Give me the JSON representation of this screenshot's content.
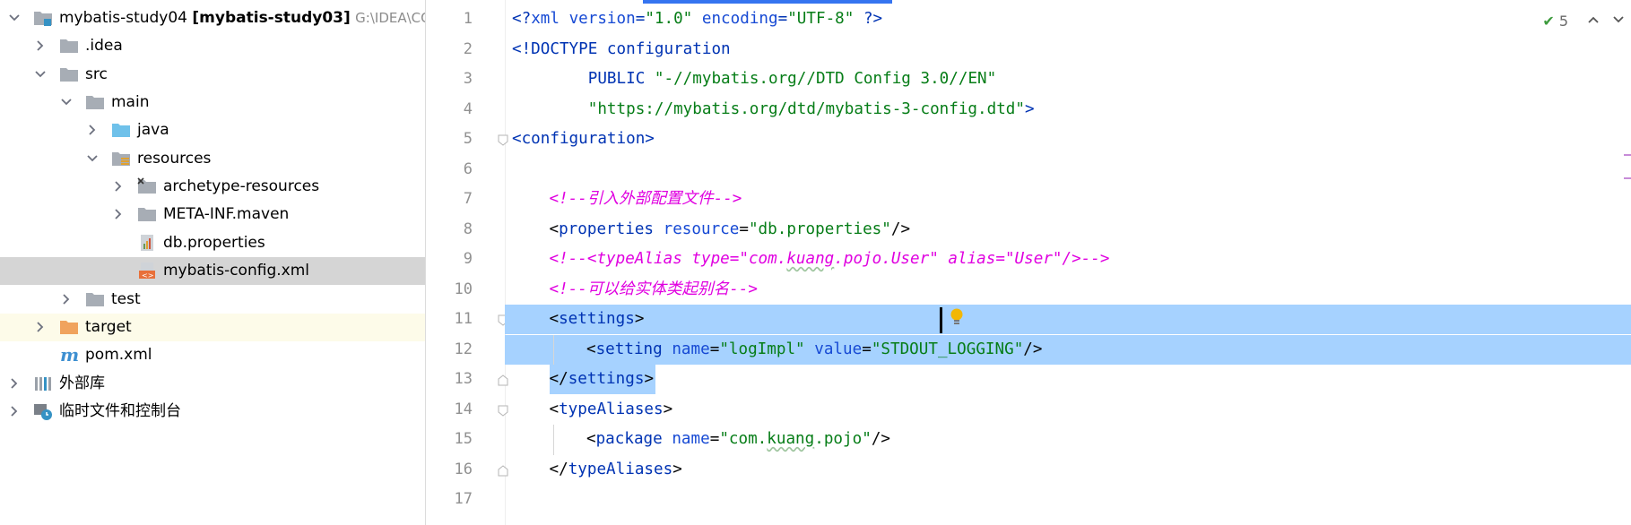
{
  "project_tree": {
    "items": [
      {
        "label": "mybatis-study04",
        "bold": "[mybatis-study03]",
        "path": "G:\\IDEA\\COD",
        "icon": "module-icon",
        "arrow": "down",
        "indent": 0
      },
      {
        "label": ".idea",
        "icon": "folder-icon",
        "arrow": "right",
        "indent": 1
      },
      {
        "label": "src",
        "icon": "folder-icon",
        "arrow": "down",
        "indent": 1
      },
      {
        "label": "main",
        "icon": "folder-icon",
        "arrow": "down",
        "indent": 2
      },
      {
        "label": "java",
        "icon": "source-folder-icon",
        "arrow": "right",
        "indent": 3
      },
      {
        "label": "resources",
        "icon": "resources-folder-icon",
        "arrow": "down",
        "indent": 3
      },
      {
        "label": "archetype-resources",
        "icon": "excluded-folder-icon",
        "arrow": "right",
        "indent": 4
      },
      {
        "label": "META-INF.maven",
        "icon": "folder-icon",
        "arrow": "right",
        "indent": 4
      },
      {
        "label": "db.properties",
        "icon": "properties-file-icon",
        "arrow": "none",
        "indent": 4
      },
      {
        "label": "mybatis-config.xml",
        "icon": "xml-file-icon",
        "arrow": "none",
        "indent": 4,
        "selected": true
      },
      {
        "label": "test",
        "icon": "folder-icon",
        "arrow": "right",
        "indent": 2
      },
      {
        "label": "target",
        "icon": "orange-folder-icon",
        "arrow": "right",
        "indent": 1,
        "excluded": true
      },
      {
        "label": "pom.xml",
        "icon": "maven-icon",
        "arrow": "none",
        "indent": 1
      },
      {
        "label": "外部库",
        "icon": "library-icon",
        "arrow": "right",
        "indent": 0
      },
      {
        "label": "临时文件和控制台",
        "icon": "scratch-icon",
        "arrow": "right",
        "indent": 0
      }
    ]
  },
  "editor": {
    "inspection_count": "5",
    "line_numbers": [
      "1",
      "2",
      "3",
      "4",
      "5",
      "6",
      "7",
      "8",
      "9",
      "10",
      "11",
      "12",
      "13",
      "14",
      "15",
      "16",
      "17"
    ],
    "lines": [
      {
        "indent": 0,
        "tokens": [
          [
            "t-tag",
            "<?"
          ],
          [
            "t-attr",
            "xml "
          ],
          [
            "t-attr",
            "version"
          ],
          [
            "t-tag",
            "="
          ],
          [
            "t-val",
            "\"1.0\""
          ],
          [
            "t-tag",
            " "
          ],
          [
            "t-attr",
            "encoding"
          ],
          [
            "t-tag",
            "="
          ],
          [
            "t-val",
            "\"UTF-8\""
          ],
          [
            "t-tag",
            " ?>"
          ]
        ]
      },
      {
        "indent": 0,
        "tokens": [
          [
            "t-tag",
            "<!DOCTYPE configuration"
          ]
        ]
      },
      {
        "indent": 0,
        "tokens": [
          [
            "t-tag",
            "        PUBLIC "
          ],
          [
            "t-val",
            "\"-//mybatis.org//DTD Config 3.0//EN\""
          ]
        ]
      },
      {
        "indent": 0,
        "tokens": [
          [
            "t-val",
            "        \"https://mybatis.org/dtd/mybatis-3-config.dtd\""
          ],
          [
            "t-tag",
            ">"
          ]
        ]
      },
      {
        "indent": 0,
        "tokens": [
          [
            "t-tag",
            "<configuration>"
          ]
        ]
      },
      {
        "indent": 0,
        "tokens": []
      },
      {
        "indent": 1,
        "tokens": [
          [
            "t-com2",
            "<!--引入外部配置文件-->"
          ]
        ]
      },
      {
        "indent": 1,
        "tokens": [
          [
            "",
            "<"
          ],
          [
            "t-tag",
            "properties "
          ],
          [
            "t-attr",
            "resource"
          ],
          [
            "",
            "="
          ],
          [
            "t-val",
            "\"db.properties\""
          ],
          [
            "",
            "/>"
          ]
        ]
      },
      {
        "indent": 1,
        "tokens": [
          [
            "t-com2",
            "<!--<typeAlias type=\"com."
          ],
          [
            "t-com2 squig",
            "kuang"
          ],
          [
            "t-com2",
            ".pojo.User\" alias=\"User\"/>-->"
          ]
        ]
      },
      {
        "indent": 1,
        "tokens": [
          [
            "t-com2",
            "<!--可以给实体类起别名-->"
          ]
        ]
      },
      {
        "indent": 1,
        "tokens": [
          [
            "",
            "<"
          ],
          [
            "t-tag",
            "settings"
          ],
          [
            "",
            ">"
          ]
        ]
      },
      {
        "indent": 2,
        "tokens": [
          [
            "",
            "<"
          ],
          [
            "t-tag",
            "setting "
          ],
          [
            "t-attr",
            "name"
          ],
          [
            "",
            "="
          ],
          [
            "t-val",
            "\"logImpl\""
          ],
          [
            "",
            " "
          ],
          [
            "t-attr",
            "value"
          ],
          [
            "",
            "="
          ],
          [
            "t-val",
            "\"STDOUT_LOGGING\""
          ],
          [
            "",
            "/>"
          ]
        ]
      },
      {
        "indent": 1,
        "tokens": [
          [
            "",
            "</"
          ],
          [
            "t-tag",
            "settings"
          ],
          [
            "",
            ">"
          ]
        ]
      },
      {
        "indent": 1,
        "tokens": [
          [
            "",
            "<"
          ],
          [
            "t-tag",
            "typeAliases"
          ],
          [
            "",
            ">"
          ]
        ]
      },
      {
        "indent": 2,
        "tokens": [
          [
            "",
            "<"
          ],
          [
            "t-tag",
            "package "
          ],
          [
            "t-attr",
            "name"
          ],
          [
            "",
            "="
          ],
          [
            "t-val",
            "\"com."
          ],
          [
            "t-val squig",
            "kuang"
          ],
          [
            "t-val",
            ".pojo\""
          ],
          [
            "",
            "/>"
          ]
        ]
      },
      {
        "indent": 1,
        "tokens": [
          [
            "",
            "</"
          ],
          [
            "t-tag",
            "typeAliases"
          ],
          [
            "",
            ">"
          ]
        ]
      },
      {
        "indent": 0,
        "tokens": []
      }
    ]
  }
}
